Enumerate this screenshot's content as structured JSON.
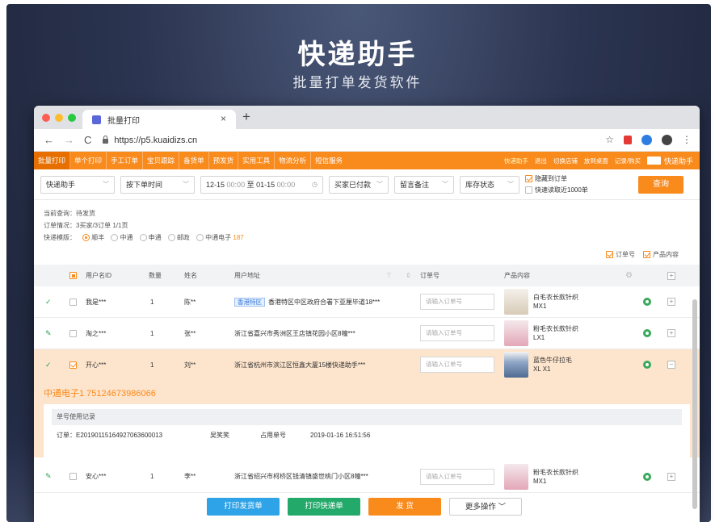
{
  "hero": {
    "title": "快递助手",
    "subtitle": "批量打单发货软件"
  },
  "browser": {
    "tab_title": "批量打印",
    "tab_close": "×",
    "new_tab": "+",
    "url": "https://p5.kuaidizs.cn",
    "traffic_lights": [
      "#fd5c52",
      "#fdbc2d",
      "#28c840"
    ]
  },
  "menu": {
    "items": [
      "批量打印",
      "单个打印",
      "手工订单",
      "宝贝跟踪",
      "备货单",
      "预发货",
      "实用工具",
      "物流分析",
      "短信服务"
    ],
    "right": [
      "快递助手",
      "退出",
      "切换店铺",
      "放到桌面",
      "记录/购买"
    ],
    "brand": "快递助手"
  },
  "filters": {
    "express": "快递助手",
    "order_time": "按下单时间",
    "date_from": "12-15",
    "time_from": "00:00",
    "to": "至",
    "date_to": "01-15",
    "time_to": "00:00",
    "buyer_paid": "买家已付款",
    "remark": "留言备注",
    "stock": "库存状态",
    "opt_hide": "隐藏到订单",
    "opt_fast": "快速读取近1000单",
    "query": "查询"
  },
  "info": {
    "current_query": "当前查询：待发货",
    "order_status": "订单情况：3买家/3订单  1/1页",
    "template_label": "快递模版：",
    "templates": [
      "顺丰",
      "中通",
      "申通",
      "邮政",
      "中通电子"
    ],
    "template_count": "187",
    "opt_order_no": "订单号",
    "opt_product": "产品内容"
  },
  "table": {
    "headers": [
      "用户名ID",
      "数量",
      "姓名",
      "用户地址",
      "订单号",
      "产品内容"
    ],
    "input_placeholder": "请输入订单号",
    "rows": [
      {
        "status": "✓",
        "user": "我是***",
        "qty": "1",
        "name": "陈**",
        "tag": "香港特区",
        "address": "香港特区中区政府合署下亚厘毕道18***",
        "product": "白毛衣长款针织MX1",
        "thumb": "coat",
        "checked": false
      },
      {
        "status": "✎",
        "user": "淘之***",
        "qty": "1",
        "name": "张**",
        "tag": "",
        "address": "浙江省嘉兴市秀洲区王店镇花园小区8幢***",
        "product": "粉毛衣长款针织LX1",
        "thumb": "pink",
        "checked": false
      },
      {
        "status": "✓",
        "user": "开心***",
        "qty": "1",
        "name": "刘**",
        "tag": "",
        "address": "浙江省杭州市滨江区恒鑫大厦15楼快递助手***",
        "product": "蓝色牛仔拉毛XL X1",
        "thumb": "jeans",
        "checked": true
      },
      {
        "status": "✎",
        "user": "安心***",
        "qty": "1",
        "name": "李**",
        "tag": "",
        "address": "浙江省绍兴市柯桥区钱清镇盛世桃门小区8幢***",
        "product": "粉毛衣长款针织MX1",
        "thumb": "pink",
        "checked": false
      }
    ]
  },
  "detail": {
    "tracking": "中通电子1  75124673986066",
    "usage_title": "单号使用记录",
    "order": "订单：E20190115164927063600013",
    "person": "吴笑笑",
    "used": "占用单号",
    "time": "2019-01-16 16:51:56"
  },
  "actions": {
    "print_invoice": "打印发货单",
    "print_express": "打印快递单",
    "ship": "发 货",
    "more": "更多操作"
  },
  "colors": {
    "accent": "#f98a1c",
    "blue": "#2ea3e8",
    "green": "#23a96a"
  }
}
